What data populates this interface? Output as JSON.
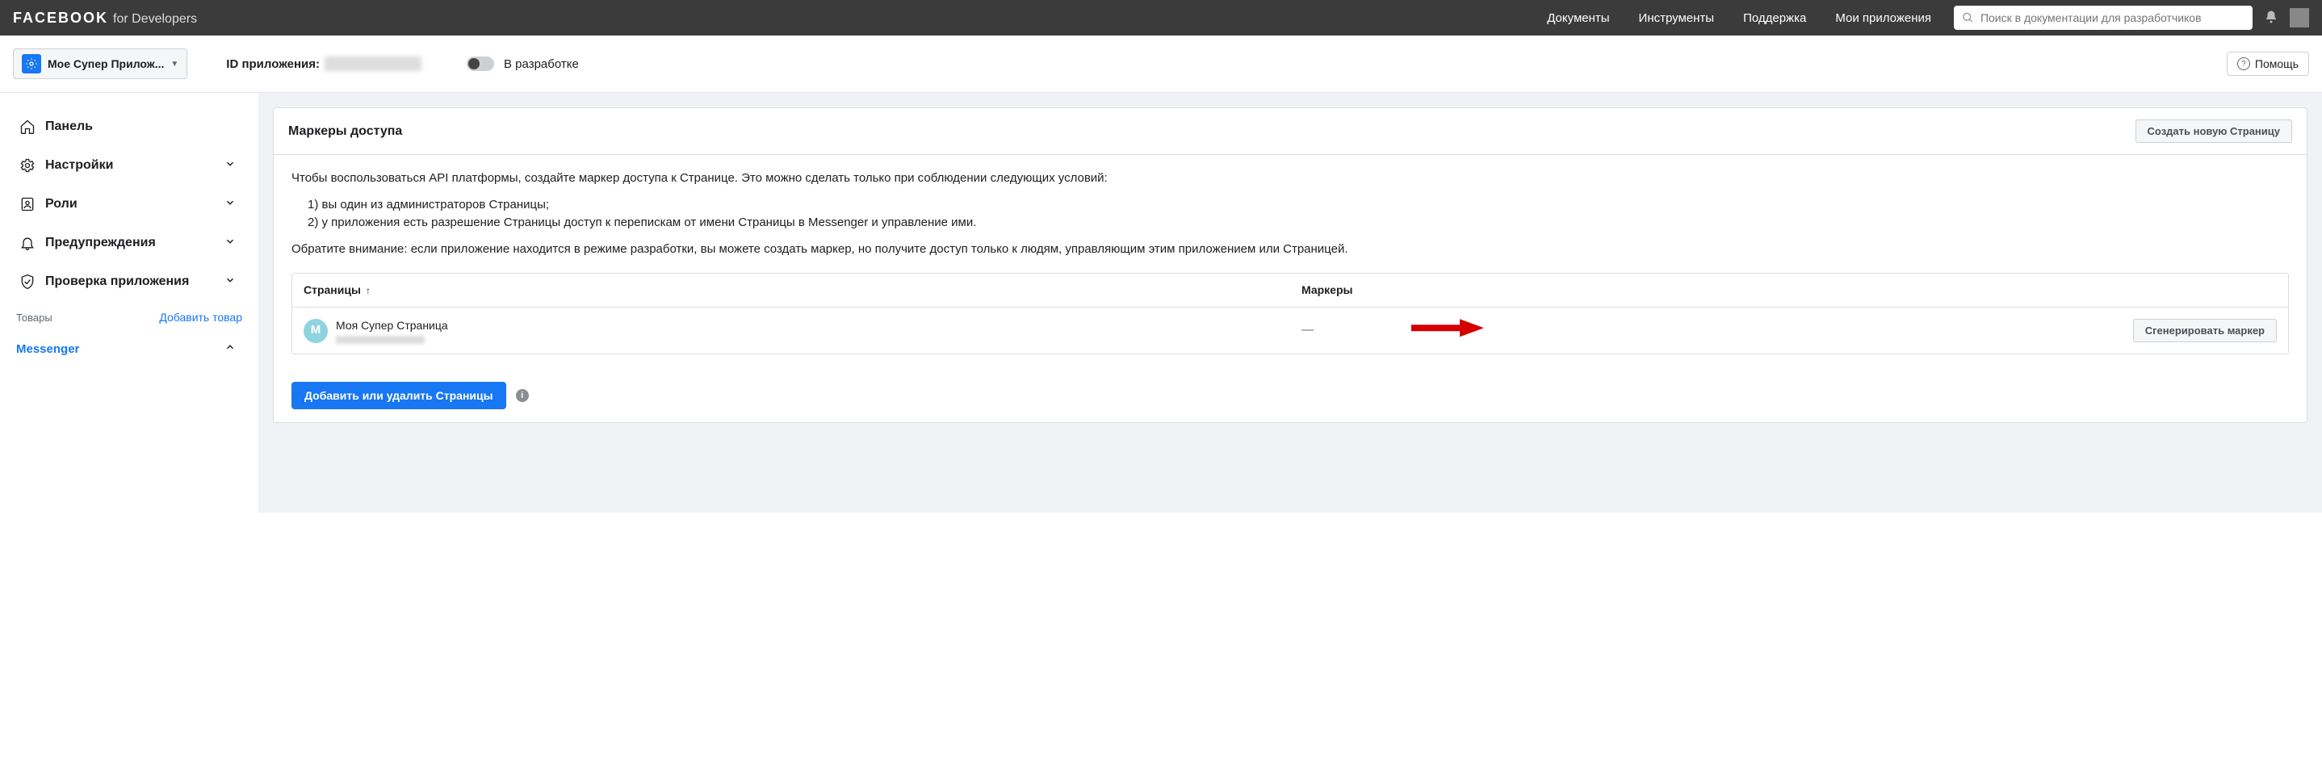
{
  "topnav": {
    "brand_fb": "FACEBOOK",
    "brand_for": "for Developers",
    "links": [
      "Документы",
      "Инструменты",
      "Поддержка",
      "Мои приложения"
    ],
    "search_placeholder": "Поиск в документации для разработчиков"
  },
  "subheader": {
    "app_name": "Мое Супер Прилож...",
    "app_id_label": "ID приложения:",
    "mode_label": "В разработке",
    "help_label": "Помощь"
  },
  "sidebar": {
    "items": [
      {
        "label": "Панель",
        "expandable": false
      },
      {
        "label": "Настройки",
        "expandable": true
      },
      {
        "label": "Роли",
        "expandable": true
      },
      {
        "label": "Предупреждения",
        "expandable": true
      },
      {
        "label": "Проверка приложения",
        "expandable": true
      }
    ],
    "section_label": "Товары",
    "add_label": "Добавить товар",
    "active_sub": "Messenger"
  },
  "card": {
    "title": "Маркеры доступа",
    "create_page_btn": "Создать новую Страницу",
    "intro": "Чтобы воспользоваться API платформы, создайте маркер доступа к Странице. Это можно сделать только при соблюдении следующих условий:",
    "cond1": "1) вы один из администраторов Страницы;",
    "cond2": "2) у приложения есть разрешение Страницы доступ к перепискам от имени Страницы в Messenger и управление ими.",
    "note": "Обратите внимание: если приложение находится в режиме разработки, вы можете создать маркер, но получите доступ только к людям, управляющим этим приложением или Страницей.",
    "table": {
      "col_pages": "Страницы",
      "col_tokens": "Маркеры",
      "rows": [
        {
          "avatar": "M",
          "name": "Моя Супер Страница",
          "token": "—",
          "gen_label": "Сгенерировать маркер"
        }
      ]
    },
    "add_remove_btn": "Добавить или удалить Страницы"
  }
}
